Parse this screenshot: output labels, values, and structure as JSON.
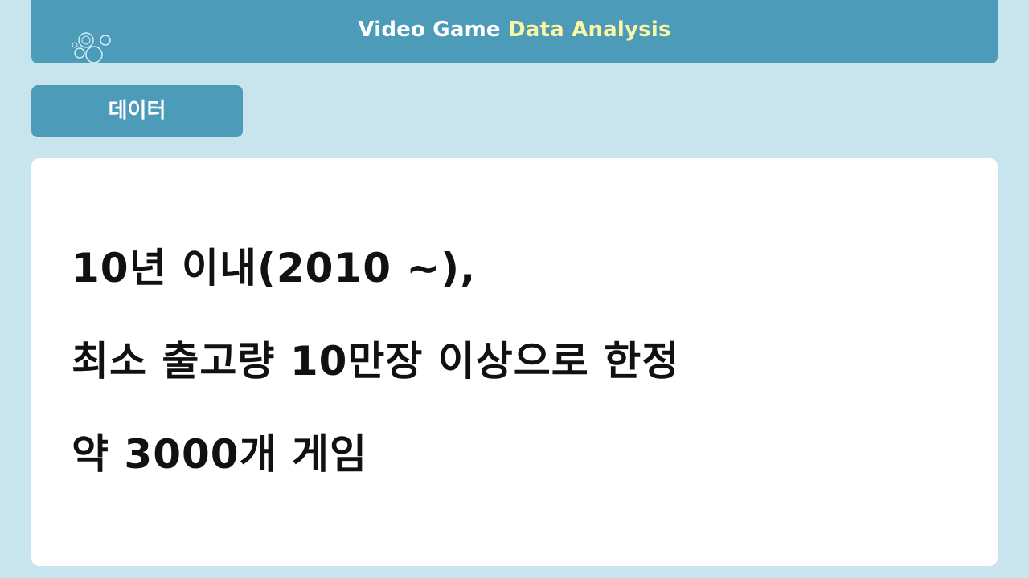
{
  "header": {
    "title_part1": "Video Game",
    "title_part2": "Data Analysis",
    "highlight_color": "#fdf6a3",
    "bar_color": "#4b9bb9"
  },
  "section": {
    "tab_label": "데이터"
  },
  "content": {
    "lines": [
      "10년 이내(2010 ~),",
      "최소 출고량 10만장 이상으로 한정",
      "약 3000개 게임"
    ]
  },
  "decor": {
    "icon": "bubbles-icon"
  }
}
